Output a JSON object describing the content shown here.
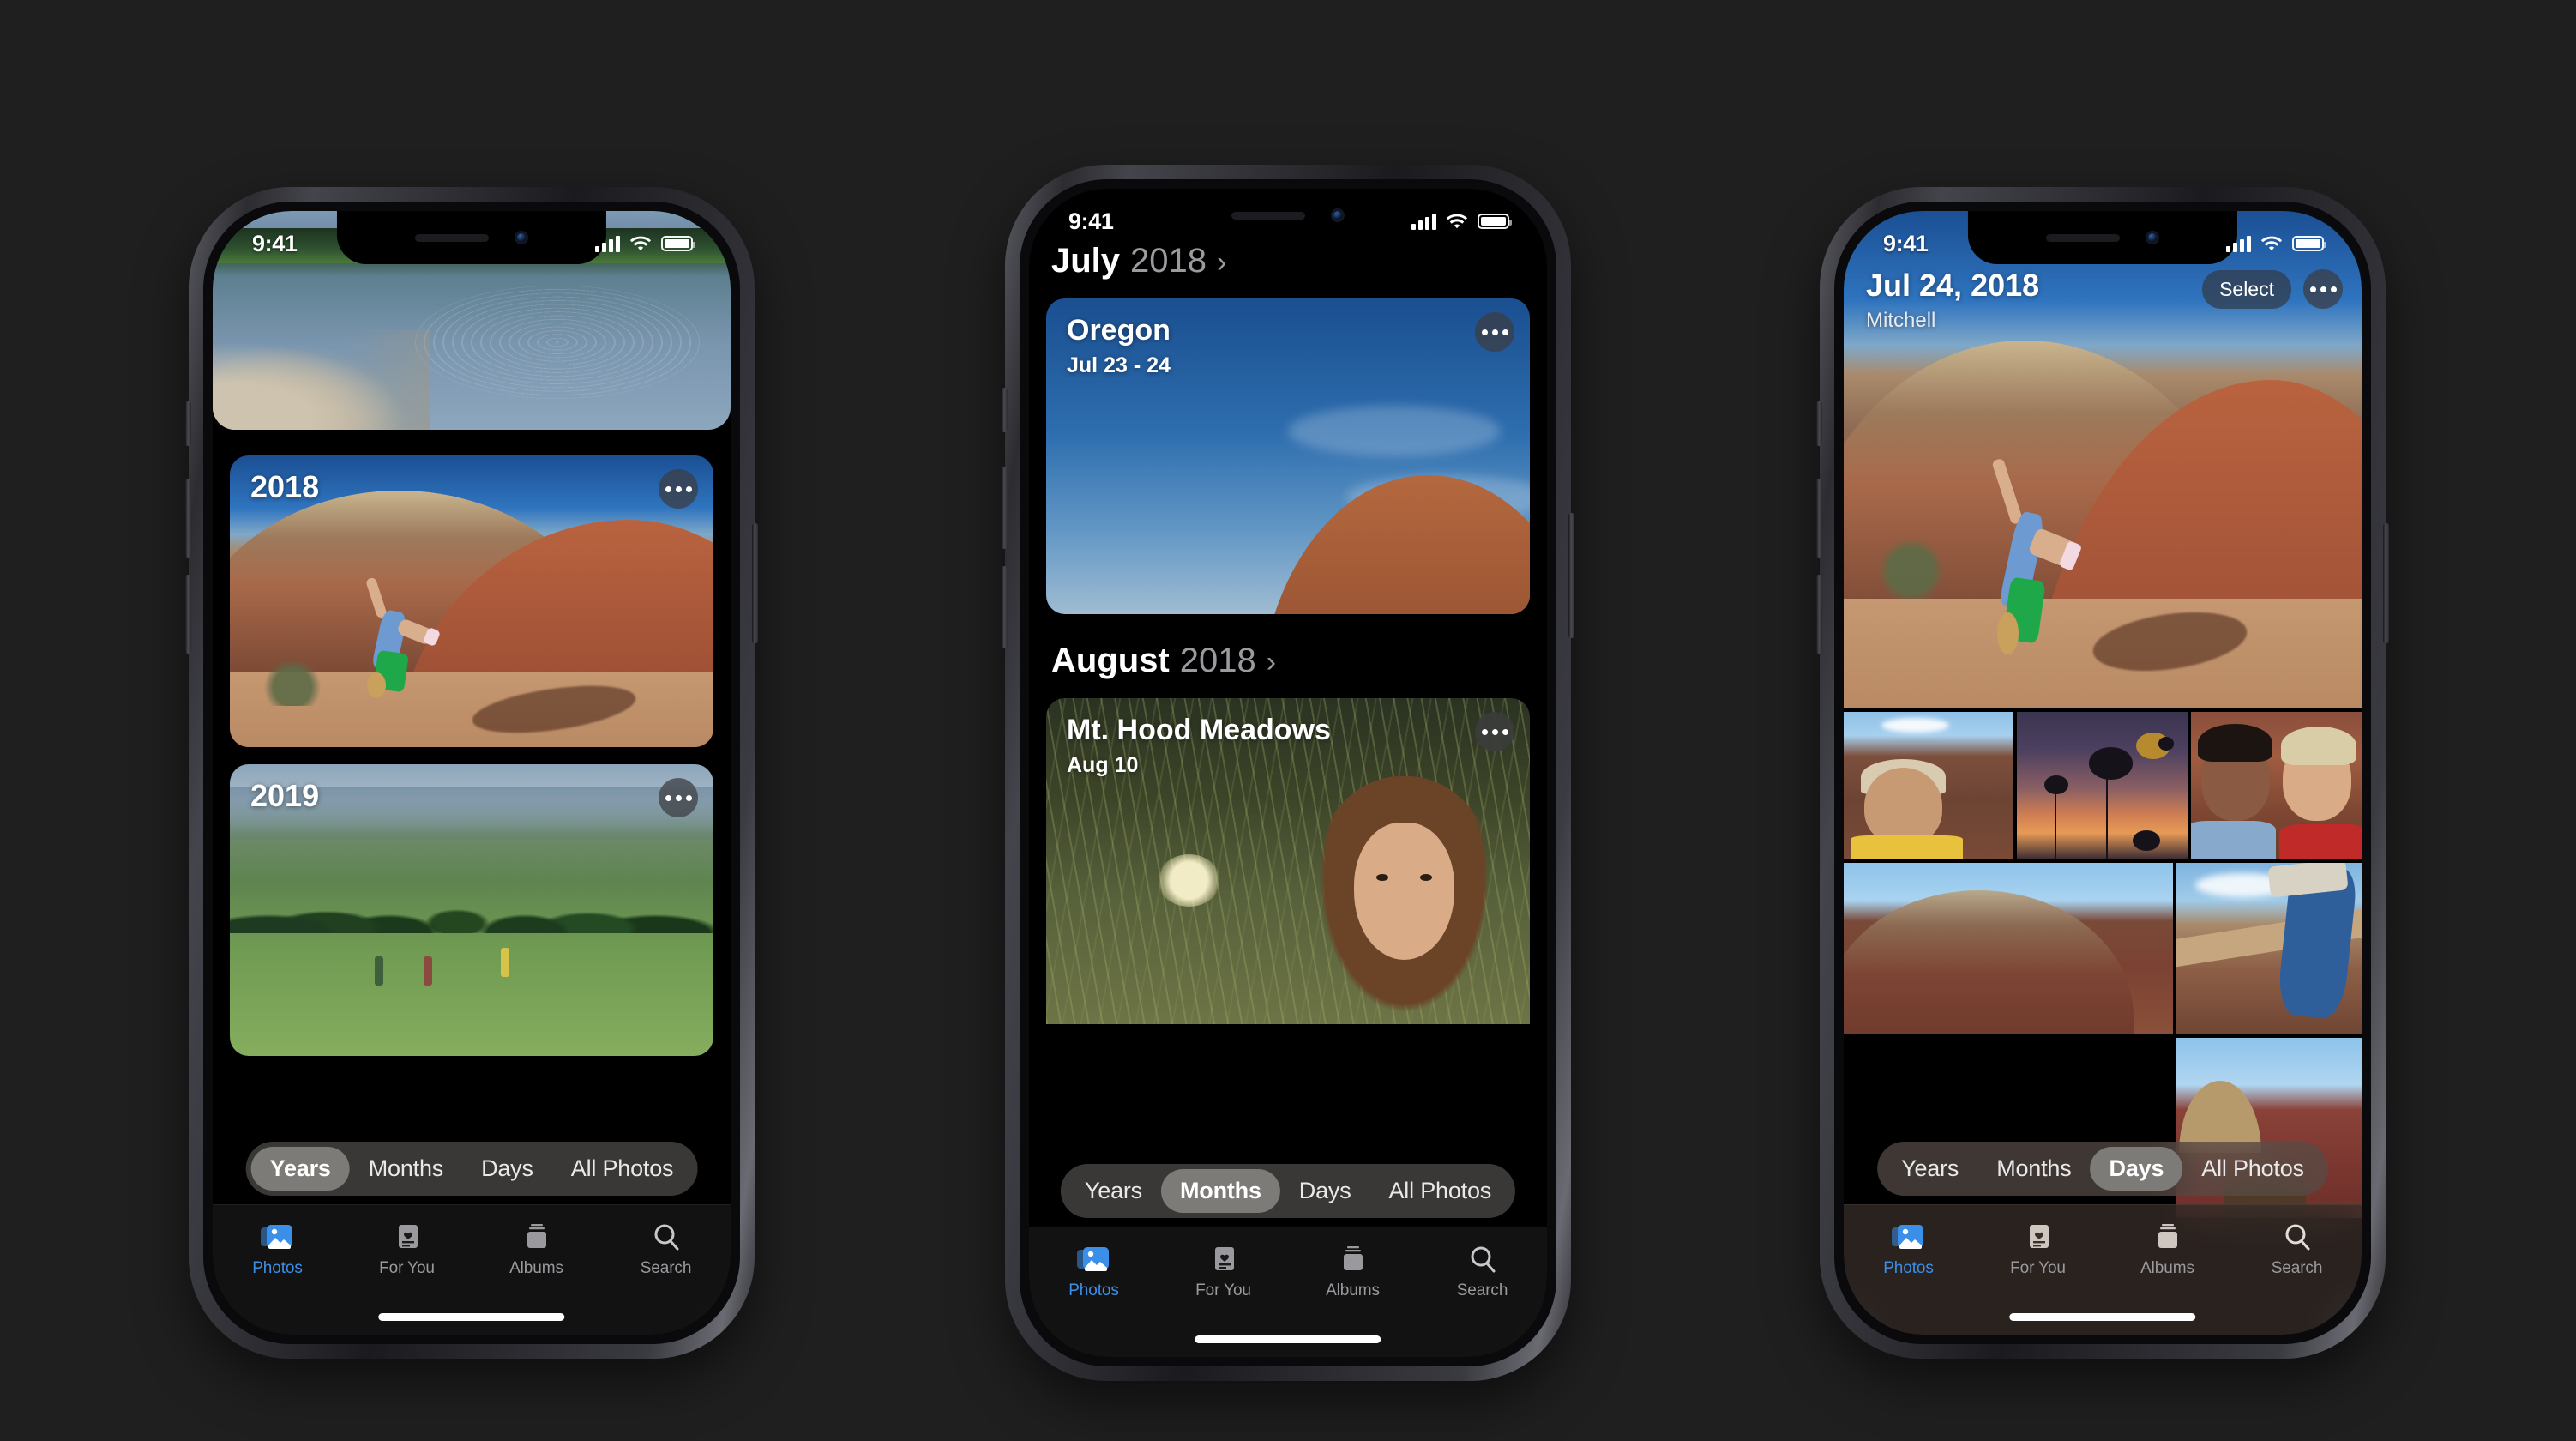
{
  "background_color": "#1f1f1f",
  "accent_color": "#3b8fe8",
  "status_bar": {
    "time": "9:41",
    "icons": [
      "cellular-signal-icon",
      "wifi-icon",
      "battery-icon"
    ]
  },
  "tab_bar": {
    "items": [
      {
        "label": "Photos",
        "icon": "photos-icon",
        "active": true
      },
      {
        "label": "For You",
        "icon": "for-you-icon",
        "active": false
      },
      {
        "label": "Albums",
        "icon": "albums-icon",
        "active": false
      },
      {
        "label": "Search",
        "icon": "search-icon",
        "active": false
      }
    ]
  },
  "segmented_control": {
    "options": [
      "Years",
      "Months",
      "Days",
      "All Photos"
    ]
  },
  "phones": [
    {
      "id": "phone-years",
      "selected_segment": "Years",
      "cards": [
        {
          "label": "",
          "sublabel": "",
          "photo": "lake-ripple-photo",
          "has_menu": false
        },
        {
          "label": "2018",
          "sublabel": "",
          "photo": "painted-hills-cartwheel-photo",
          "has_menu": true
        },
        {
          "label": "2019",
          "sublabel": "",
          "photo": "mountain-meadow-photo",
          "has_menu": true
        }
      ]
    },
    {
      "id": "phone-months",
      "selected_segment": "Months",
      "sections": [
        {
          "month": "July",
          "year": "2018",
          "chevron": "chevron-right-icon",
          "card": {
            "title": "Oregon",
            "subtitle": "Jul 23 - 24",
            "photo": "oregon-sky-hills-photo",
            "has_menu": true
          }
        },
        {
          "month": "August",
          "year": "2018",
          "chevron": "chevron-right-icon",
          "card": {
            "title": "Mt. Hood Meadows",
            "subtitle": "Aug 10",
            "photo": "meadow-portrait-photo",
            "has_menu": true
          }
        }
      ]
    },
    {
      "id": "phone-days",
      "selected_segment": "Days",
      "header": {
        "date": "Jul 24, 2018",
        "place": "Mitchell",
        "select_label": "Select",
        "menu_icon": "ellipsis-icon"
      },
      "grid": {
        "hero_photo": "cartwheel-hero-photo",
        "row1": [
          "boy-in-hills-photo",
          "sunset-flowers-photo",
          "couple-selfie-photo"
        ],
        "row2": [
          "big-red-hill-photo",
          "shoe-trail-photo"
        ],
        "row3": [
          "red-hill-head-photo"
        ]
      }
    }
  ]
}
